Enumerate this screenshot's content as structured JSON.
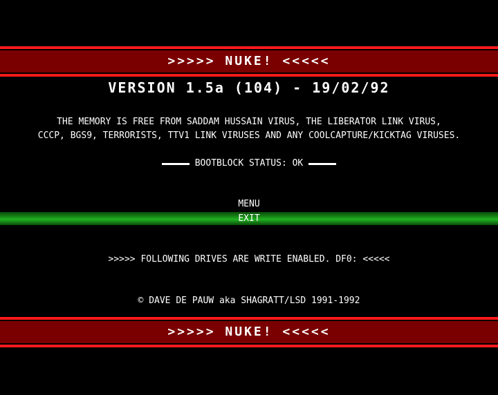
{
  "banner": {
    "title": ">>>>> NUKE! <<<<<"
  },
  "version_line": "VERSION 1.5a (104) - 19/02/92",
  "memory_message": {
    "line1": "THE MEMORY IS FREE FROM SADDAM HUSSAIN VIRUS, THE LIBERATOR LINK VIRUS,",
    "line2": "CCCP, BGS9, TERRORISTS, TTV1 LINK VIRUSES AND ANY COOLCAPTURE/KICKTAG VIRUSES."
  },
  "bootblock_status": "BOOTBLOCK STATUS: OK",
  "menu": {
    "label": "MENU",
    "items": [
      "EXIT"
    ]
  },
  "drives_line": ">>>>> FOLLOWING DRIVES ARE WRITE ENABLED. DF0: <<<<<",
  "copyright": "© DAVE DE PAUW aka SHAGRATT/LSD 1991-1992",
  "colors": {
    "background": "#000000",
    "banner_border": "#ff1a1a",
    "banner_fill": "#7a0000",
    "selection_bar": "#1a9a1a",
    "text": "#ffffff"
  }
}
